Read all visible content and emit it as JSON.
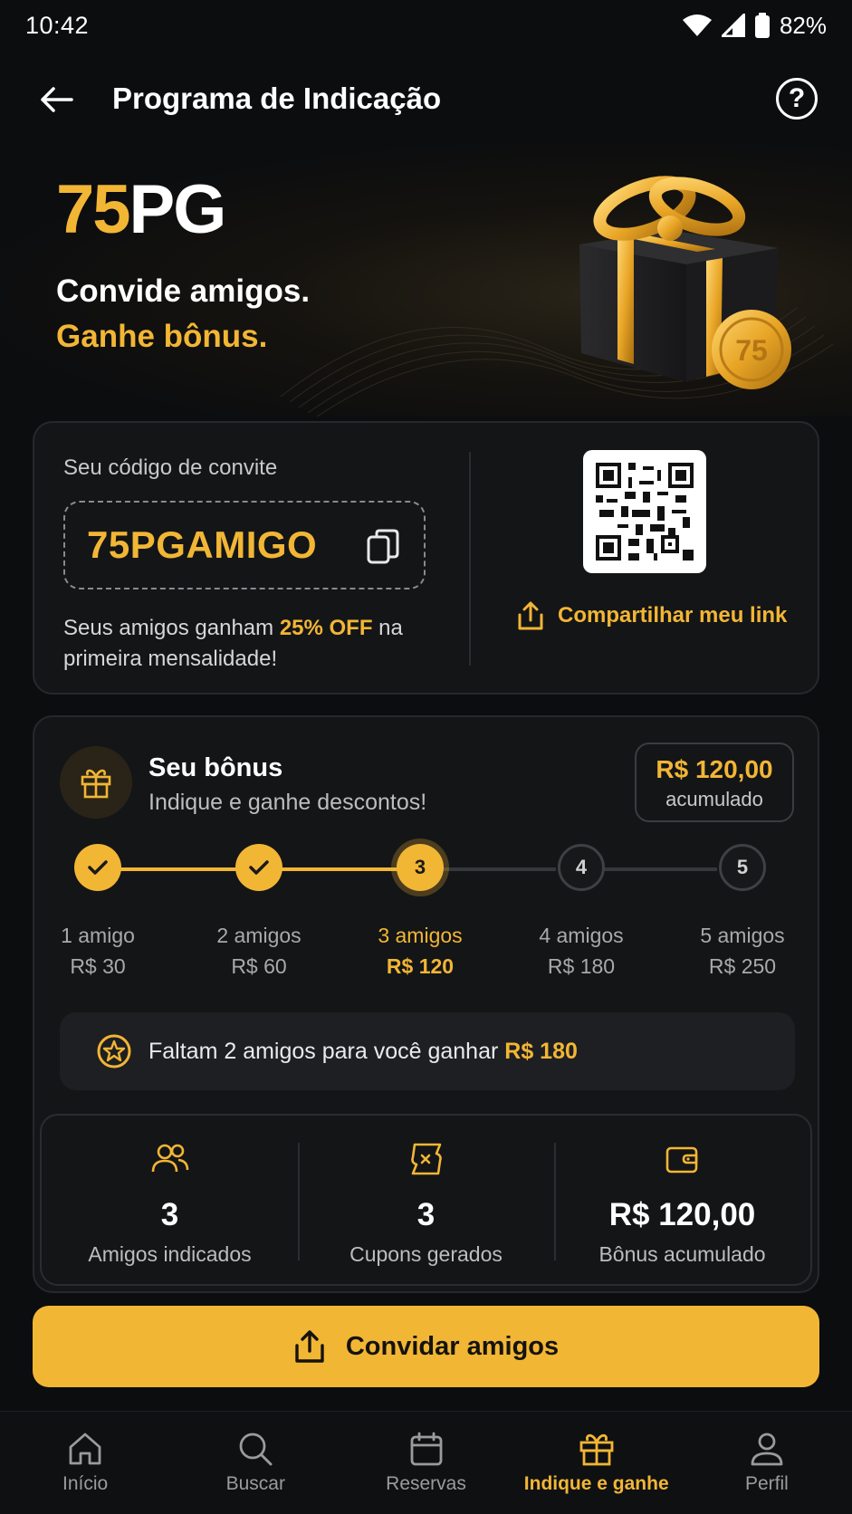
{
  "status_bar": {
    "time": "10:42",
    "battery": "82%"
  },
  "header": {
    "title": "Programa de Indicação"
  },
  "hero": {
    "brand_accent": "75",
    "brand_rest": "PG",
    "line1": "Convide amigos.",
    "line2": "Ganhe bônus.",
    "coin_text": "75"
  },
  "invite": {
    "label": "Seu código de convite",
    "code": "75PGAMIGO",
    "desc_before": "Seus amigos ganham ",
    "desc_highlight": "25% OFF",
    "desc_after": " na primeira mensalidade!",
    "share_label": "Compartilhar meu link"
  },
  "bonus": {
    "title": "Seu bônus",
    "subtitle": "Indique e ganhe descontos!",
    "total_value": "R$ 120,00",
    "total_label": "acumulado",
    "steps": [
      {
        "number": "1",
        "friends": "1 amigo",
        "reward": "R$ 30",
        "state": "done"
      },
      {
        "number": "2",
        "friends": "2 amigos",
        "reward": "R$ 60",
        "state": "done"
      },
      {
        "number": "3",
        "friends": "3 amigos",
        "reward": "R$ 120",
        "state": "current"
      },
      {
        "number": "4",
        "friends": "4 amigos",
        "reward": "R$ 180",
        "state": "todo"
      },
      {
        "number": "5",
        "friends": "5 amigos",
        "reward": "R$ 250",
        "state": "todo"
      }
    ],
    "remaining_before": "Faltam 2 amigos para você ganhar ",
    "remaining_highlight": "R$ 180"
  },
  "stats": [
    {
      "value": "3",
      "label": "Amigos indicados",
      "icon": "users-icon"
    },
    {
      "value": "3",
      "label": "Cupons gerados",
      "icon": "coupon-icon"
    },
    {
      "value": "R$ 120,00",
      "label": "Bônus acumulado",
      "icon": "wallet-icon"
    }
  ],
  "cta": {
    "label": "Convidar amigos"
  },
  "nav": [
    {
      "label": "Início",
      "icon": "home-icon"
    },
    {
      "label": "Buscar",
      "icon": "search-icon"
    },
    {
      "label": "Reservas",
      "icon": "calendar-icon"
    },
    {
      "label": "Indique e ganhe",
      "icon": "gift-icon",
      "active": true
    },
    {
      "label": "Perfil",
      "icon": "profile-icon"
    }
  ],
  "colors": {
    "accent": "#f2b635",
    "background": "#0c0d0f",
    "card": "#141517"
  }
}
